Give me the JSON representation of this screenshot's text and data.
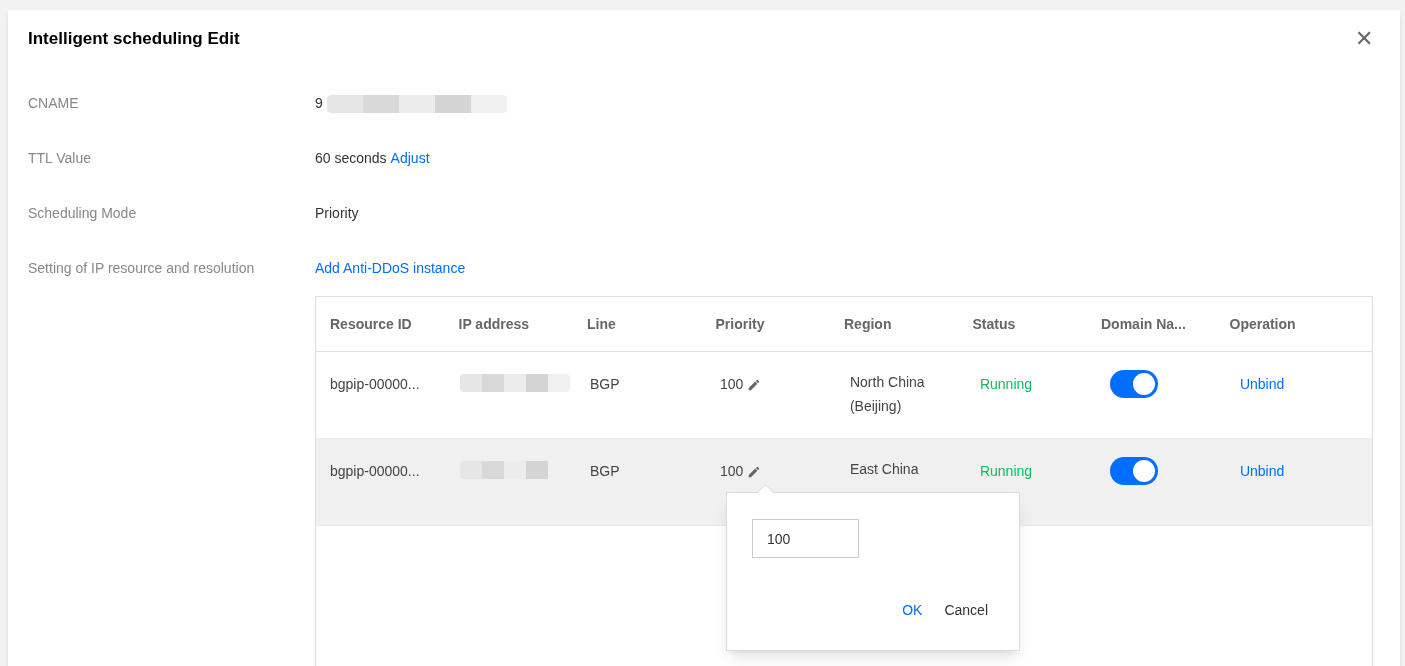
{
  "dialog": {
    "title": "Intelligent scheduling Edit",
    "close": "✕"
  },
  "fields": [
    {
      "label": "CNAME",
      "value": "9",
      "redacted": true
    },
    {
      "label": "TTL Value",
      "value": "60 seconds",
      "link": "Adjust"
    },
    {
      "label": "Scheduling Mode",
      "value": "Priority"
    },
    {
      "label": "Setting of IP resource and resolution",
      "link": "Add Anti-DDoS instance"
    }
  ],
  "table": {
    "columns": [
      "Resource ID",
      "IP address",
      "Line",
      "Priority",
      "Region",
      "Status",
      "Domain Na...",
      "Operation"
    ],
    "rows": [
      {
        "resource_id": "bgpip-00000...",
        "line": "BGP",
        "priority": "100",
        "region": [
          "North China",
          "(Beijing)"
        ],
        "status": "Running",
        "domain_on": true,
        "operation": "Unbind",
        "highlighted": false
      },
      {
        "resource_id": "bgpip-00000...",
        "line": "BGP",
        "priority": "100",
        "region": [
          "East China"
        ],
        "status": "Running",
        "domain_on": true,
        "operation": "Unbind",
        "highlighted": true
      }
    ]
  },
  "popover": {
    "value": "100",
    "ok": "OK",
    "cancel": "Cancel"
  }
}
